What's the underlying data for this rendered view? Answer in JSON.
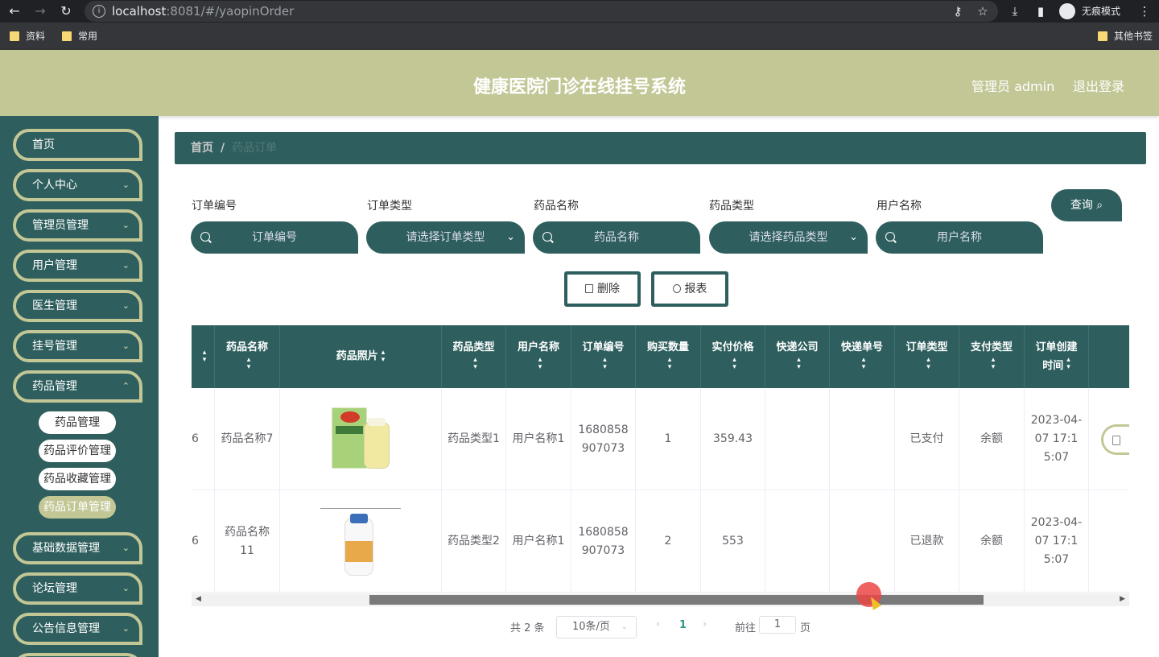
{
  "browser": {
    "url_host": "localhost",
    "url_rest": ":8081/#/yaopinOrder",
    "incognito_label": "无痕模式",
    "bookmarks": [
      "资料",
      "常用"
    ],
    "other_bookmarks": "其他书签"
  },
  "header": {
    "title": "健康医院门诊在线挂号系统",
    "user": "管理员 admin",
    "logout": "退出登录"
  },
  "sidebar": {
    "items": [
      {
        "label": "首页"
      },
      {
        "label": "个人中心"
      },
      {
        "label": "管理员管理"
      },
      {
        "label": "用户管理"
      },
      {
        "label": "医生管理"
      },
      {
        "label": "挂号管理"
      },
      {
        "label": "药品管理"
      },
      {
        "label": "基础数据管理"
      },
      {
        "label": "论坛管理"
      },
      {
        "label": "公告信息管理"
      }
    ],
    "sub_items": [
      {
        "label": "药品管理"
      },
      {
        "label": "药品评价管理"
      },
      {
        "label": "药品收藏管理"
      },
      {
        "label": "药品订单管理"
      }
    ]
  },
  "breadcrumb": {
    "home": "首页",
    "separator": "/",
    "current": "药品订单"
  },
  "filters": [
    {
      "label": "订单编号",
      "placeholder": "订单编号"
    },
    {
      "label": "订单类型",
      "placeholder": "请选择订单类型"
    },
    {
      "label": "药品名称",
      "placeholder": "药品名称"
    },
    {
      "label": "药品类型",
      "placeholder": "请选择药品类型"
    },
    {
      "label": "用户名称",
      "placeholder": "用户名称"
    }
  ],
  "buttons": {
    "query": "查询",
    "delete": "删除",
    "report": "报表"
  },
  "table": {
    "headers": [
      "药品名称",
      "药品照片",
      "药品类型",
      "用户名称",
      "订单编号",
      "购买数量",
      "实付价格",
      "快递公司",
      "快递单号",
      "订单类型",
      "支付类型",
      "订单创建时间"
    ],
    "rows": [
      {
        "index_partial": "6",
        "name": "药品名称7",
        "type": "药品类型1",
        "user": "用户名称1",
        "order_no": "1680858907073",
        "qty": "1",
        "price": "359.43",
        "courier": "",
        "tracking": "",
        "order_type": "已支付",
        "pay_type": "余额",
        "created": "2023-04-07 17:15:07"
      },
      {
        "index_partial": "6",
        "name": "药品名称11",
        "type": "药品类型2",
        "user": "用户名称1",
        "order_no": "1680858907073",
        "qty": "2",
        "price": "553",
        "courier": "",
        "tracking": "",
        "order_type": "已退款",
        "pay_type": "余额",
        "created": "2023-04-07 17:15:07"
      }
    ]
  },
  "pagination": {
    "total": "共 2 条",
    "page_size": "10条/页",
    "current_page": "1",
    "goto_label": "前往",
    "goto_value": "1",
    "page_suffix": "页"
  }
}
